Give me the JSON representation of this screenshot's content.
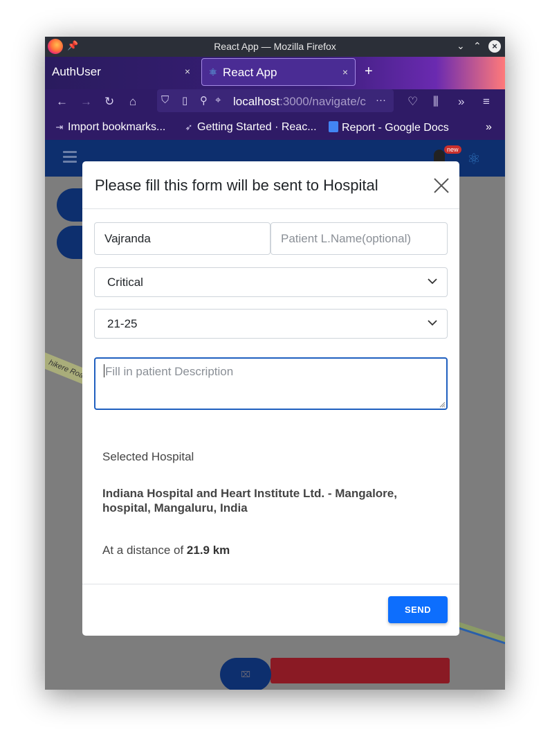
{
  "window": {
    "title": "React App — Mozilla Firefox",
    "minimize": "⌄",
    "maximize": "⌃",
    "close": "×"
  },
  "tabs": [
    {
      "label": "AuthUser",
      "close": "×"
    },
    {
      "label": "React App",
      "close": "×"
    }
  ],
  "new_tab": "+",
  "url": {
    "host": "localhost",
    "rest": ":3000/navigate/c",
    "more": "···"
  },
  "bookmarks": [
    {
      "label": "Import bookmarks..."
    },
    {
      "label": "Getting Started · Reac..."
    },
    {
      "label": "Report - Google Docs"
    }
  ],
  "app": {
    "badge": "new",
    "road_label": "hikere Road",
    "fab_icon": "⌧"
  },
  "modal": {
    "title": "Please fill this form will be sent to Hospital",
    "first_name_value": "Vajranda",
    "last_name_placeholder": "Patient L.Name(optional)",
    "severity_value": "Critical",
    "age_value": "21-25",
    "description_placeholder": "Fill in patient Description",
    "selected_label": "Selected Hospital",
    "hospital_name": "Indiana Hospital and Heart Institute Ltd. - Mangalore, hospital, Mangaluru, India",
    "distance_prefix": "At a distance of ",
    "distance_value": "21.9 km",
    "send_label": "SEND"
  },
  "colors": {
    "primary": "#0d6efd",
    "appbar": "#0d2f6e",
    "focus_border": "#1f5fbf"
  }
}
